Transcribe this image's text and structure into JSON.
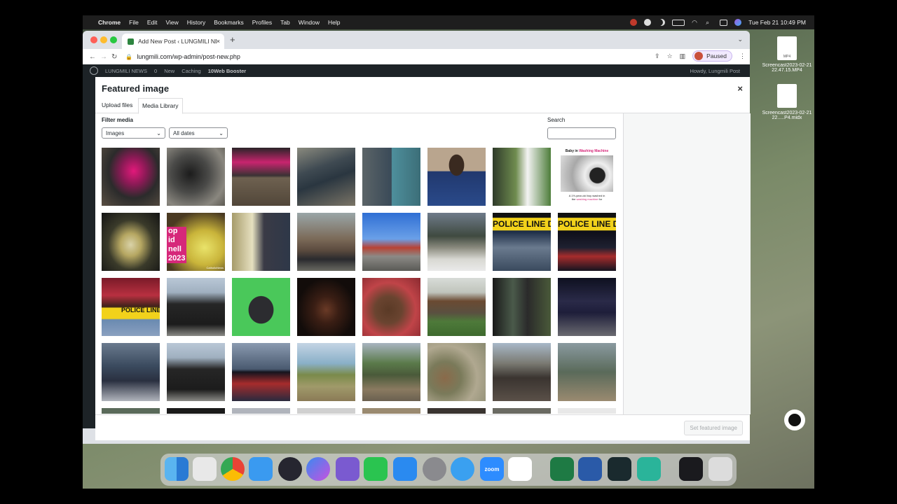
{
  "menubar": {
    "app": "Chrome",
    "items": [
      "File",
      "Edit",
      "View",
      "History",
      "Bookmarks",
      "Profiles",
      "Tab",
      "Window",
      "Help"
    ],
    "datetime": "Tue Feb 21  10:49 PM"
  },
  "browser": {
    "tab_title": "Add New Post ‹ LUNGMILI NEWS — WordPress",
    "url": "lungmili.com/wp-admin/post-new.php",
    "profile_status": "Paused"
  },
  "wp_admin_bar": {
    "site": "LUNGMILI NEWS",
    "comments": "0",
    "new": "New",
    "caching": "Caching",
    "booster": "10Web Booster",
    "howdy": "Howdy, Lungmili Post"
  },
  "modal": {
    "title": "Featured image",
    "close": "×",
    "tabs": [
      "Upload files",
      "Media Library"
    ],
    "active_tab": "Media Library",
    "filter_label": "Filter media",
    "type_filter": "Images",
    "date_filter": "All dates",
    "search_label": "Search",
    "search_value": "",
    "set_button": "Set featured image"
  },
  "thumb_texts": {
    "police": "POLICE LINE D",
    "police_small": "POLICE LINE",
    "baby_title_1": "Baby in ",
    "baby_title_2": "Washing Machine",
    "baby_caption_1": "A 1½-year-old boy washed in",
    "baby_caption_2": "the ",
    "baby_caption_3": "washing machine",
    "baby_caption_4": " for",
    "bishop_1": "op",
    "bishop_2": "id",
    "bishop_3": "nell",
    "bishop_4": "2023",
    "bishop_tag": "CatholicNews"
  },
  "desktop": {
    "icons": [
      {
        "label": "Screencast2023-02-21 22.47.15.MP4"
      },
      {
        "label": "Screencast2023-02-21 22.....P4.midx"
      }
    ],
    "mp4_tag": "MP4"
  },
  "dock": {
    "zoom": "zoom"
  },
  "colors": {
    "wp_dark": "#1d2327",
    "accent_pink": "#d6287a",
    "police_yellow": "#f2d21b"
  }
}
